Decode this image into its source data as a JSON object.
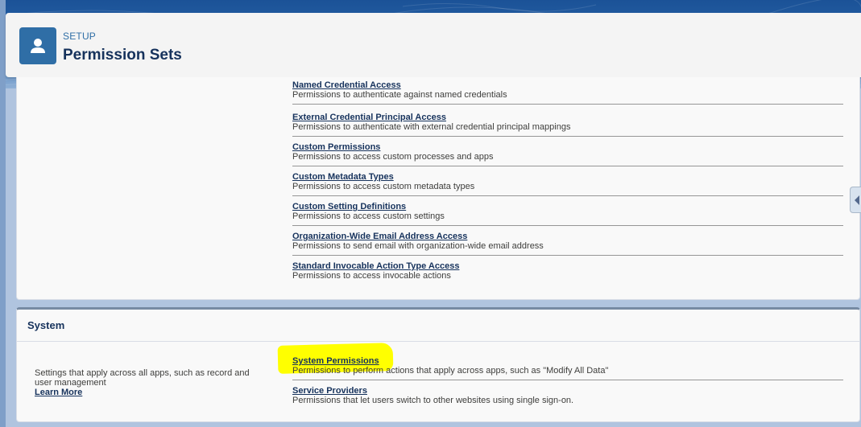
{
  "header": {
    "setup_label": "SETUP",
    "title": "Permission Sets",
    "icon": "user-icon"
  },
  "apps_section": {
    "items": [
      {
        "link": "Named Credential Access",
        "description": "Permissions to authenticate against named credentials"
      },
      {
        "link": "External Credential Principal Access",
        "description": "Permissions to authenticate with external credential principal mappings"
      },
      {
        "link": "Custom Permissions",
        "description": "Permissions to access custom processes and apps"
      },
      {
        "link": "Custom Metadata Types",
        "description": "Permissions to access custom metadata types"
      },
      {
        "link": "Custom Setting Definitions",
        "description": "Permissions to access custom settings"
      },
      {
        "link": "Organization-Wide Email Address Access",
        "description": "Permissions to send email with organization-wide email address"
      },
      {
        "link": "Standard Invocable Action Type Access",
        "description": "Permissions to access invocable actions"
      }
    ]
  },
  "system_section": {
    "title": "System",
    "description": "Settings that apply across all apps, such as record and user management",
    "learn_more": "Learn More",
    "items": [
      {
        "link": "System Permissions",
        "description": "Permissions to perform actions that apply across apps, such as \"Modify All Data\""
      },
      {
        "link": "Service Providers",
        "description": "Permissions that let users switch to other websites using single sign-on."
      }
    ]
  },
  "colors": {
    "brand_blue": "#2f6ea6",
    "highlight": "#ffff00",
    "link": "#16325c"
  }
}
